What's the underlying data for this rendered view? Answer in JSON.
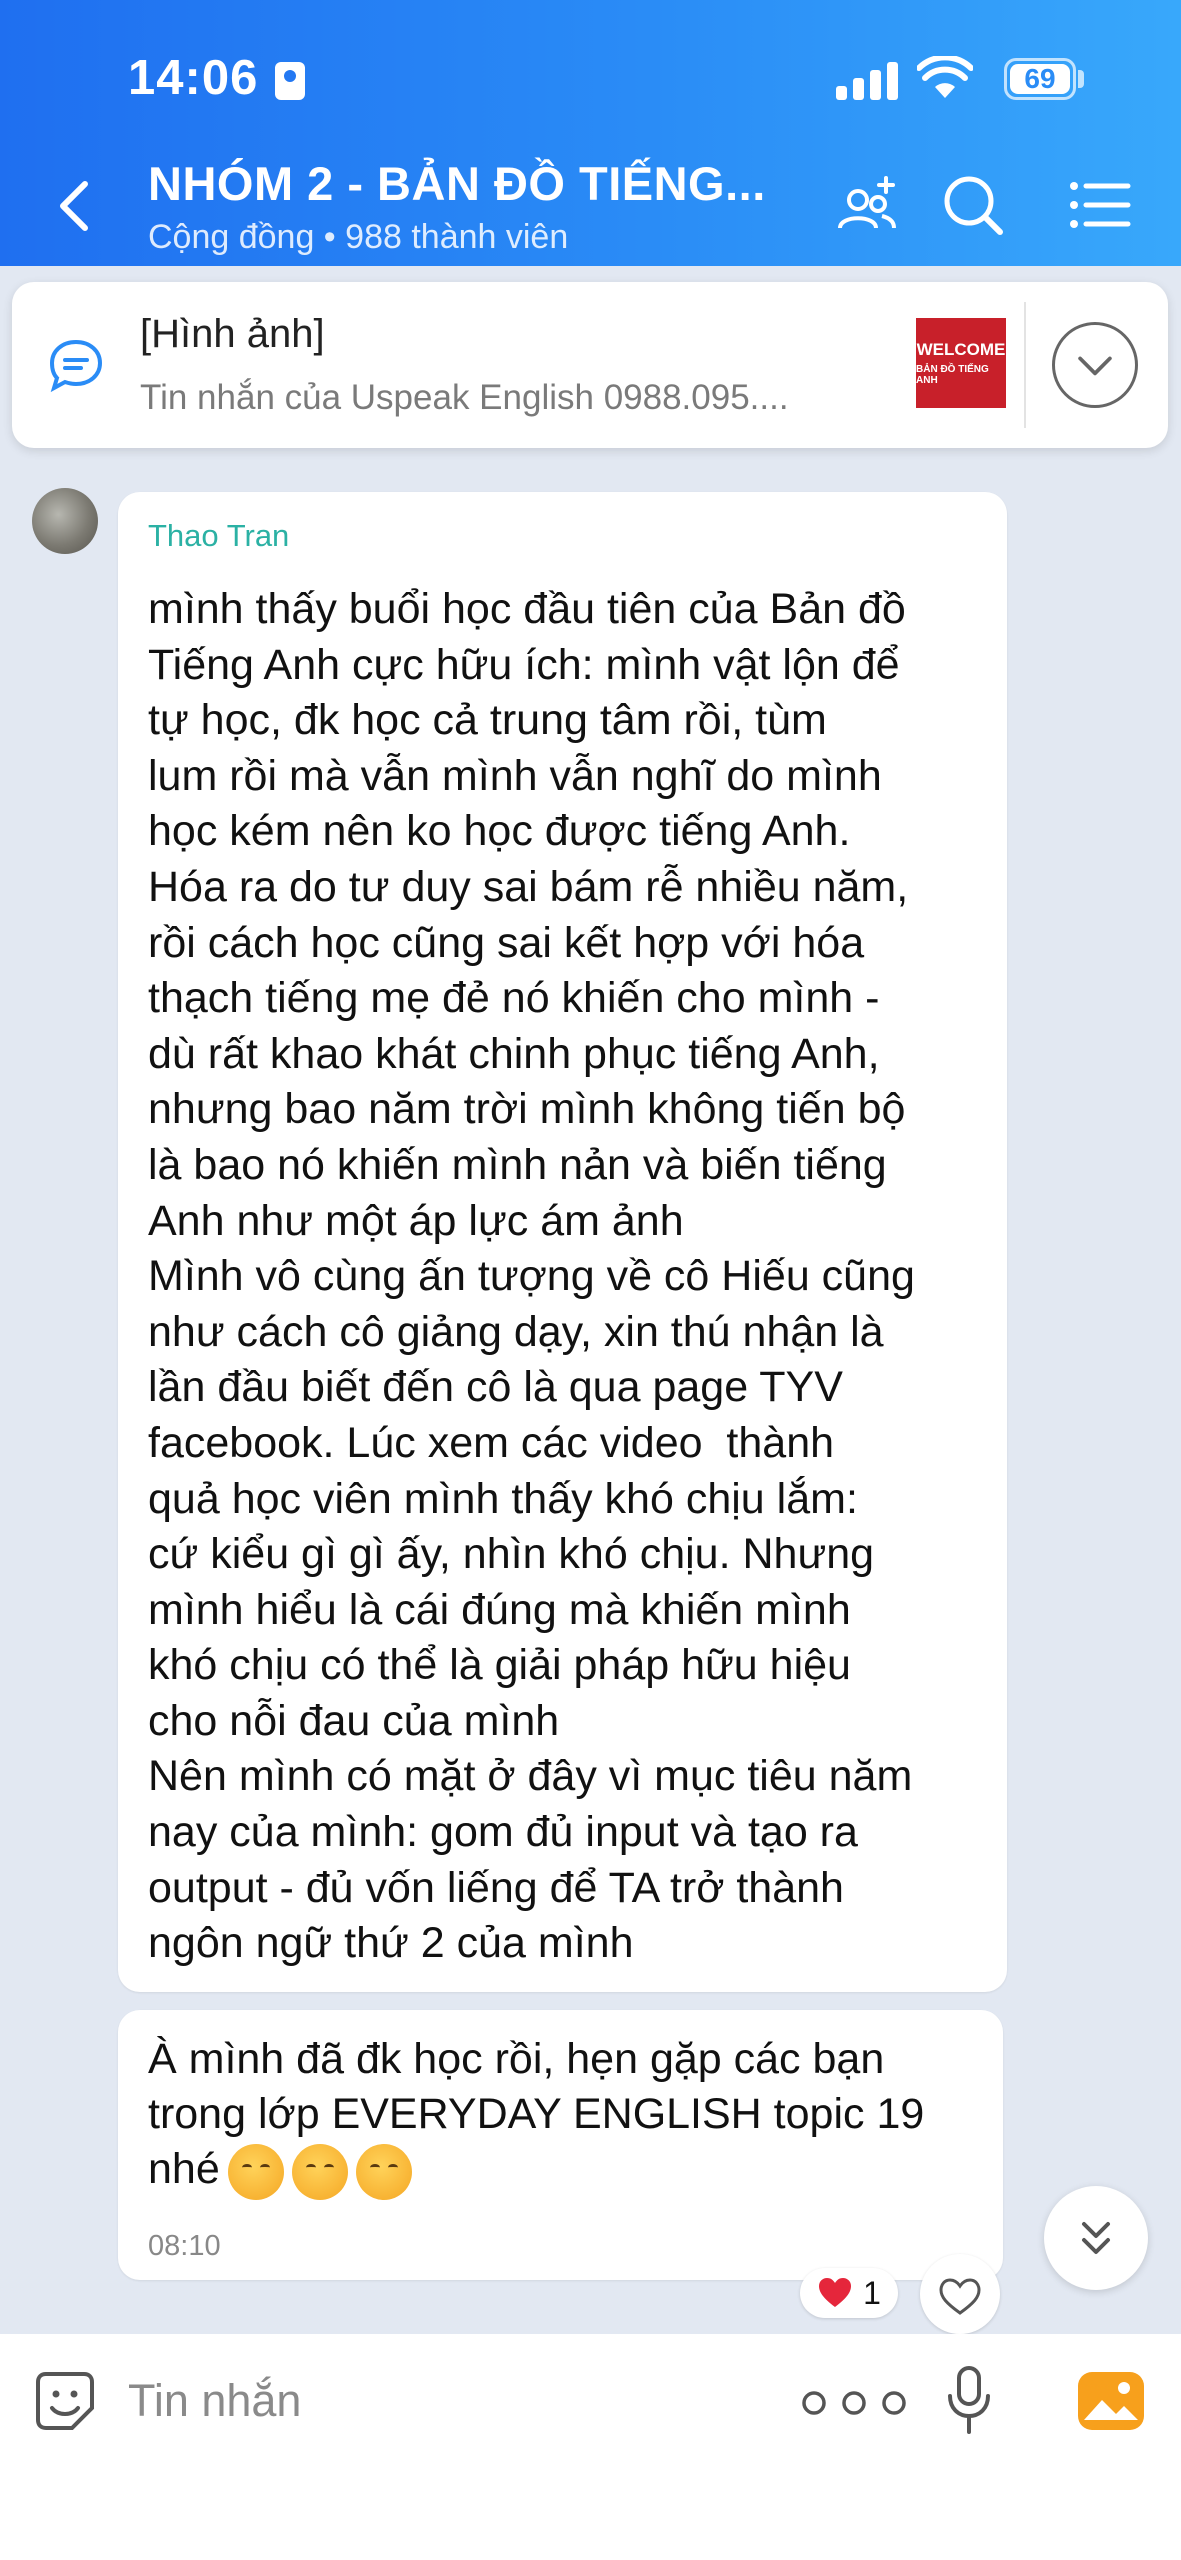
{
  "status_bar": {
    "time": "14:06",
    "battery": "69"
  },
  "header": {
    "title": "NHÓM 2 - BẢN ĐỒ TIẾNG...",
    "subtitle": "Cộng đồng • 988 thành viên"
  },
  "pinned": {
    "title": "[Hình ảnh]",
    "subtitle": "Tin nhắn của Uspeak English 0988.095....",
    "thumb_line1": "WELCOME",
    "thumb_line2": "BẢN ĐỒ TIẾNG ANH"
  },
  "messages": [
    {
      "sender": "Thao Tran",
      "text": "mình thấy buổi học đầu tiên của Bản đồ\nTiếng Anh cực hữu ích: mình vật lộn để\ntự học, đk học cả trung tâm rồi, tùm\nlum rồi mà vẫn mình vẫn nghĩ do mình\nhọc kém nên ko học được tiếng Anh.\nHóa ra do tư duy sai bám rễ nhiều năm,\nrồi cách học cũng sai kết hợp với hóa\nthạch tiếng mẹ đẻ nó khiến cho mình -\ndù rất khao khát chinh phục tiếng Anh,\nnhưng bao năm trời mình không tiến bộ\nlà bao nó khiến mình nản và biến tiếng\nAnh như một áp lực ám ảnh\nMình vô cùng ấn tượng về cô Hiếu cũng\nnhư cách cô giảng dạy, xin thú nhận là\nlần đầu biết đến cô là qua page TYV\nfacebook. Lúc xem các video  thành\nquả học viên mình thấy khó chịu lắm:\ncứ kiểu gì gì ấy, nhìn khó chịu. Nhưng\nmình hiểu là cái đúng mà khiến mình\nkhó chịu có thể là giải pháp hữu hiệu\ncho nỗi đau của mình\nNên mình có mặt ở đây vì mục tiêu năm\nnay của mình: gom đủ input và tạo ra\noutput - đủ vốn liếng để TA trở thành\nngôn ngữ thứ 2 của mình"
    },
    {
      "text": "À mình đã đk học rồi, hẹn gặp các bạn\ntrong lớp EVERYDAY ENGLISH topic 19\nnhé",
      "time": "08:10",
      "reaction_count": "1"
    }
  ],
  "input": {
    "placeholder": "Tin nhắn"
  },
  "icons": {
    "back": "chevron-left-icon",
    "members": "add-members-icon",
    "search": "search-icon",
    "menu": "list-menu-icon",
    "pinned": "chat-bubble-icon",
    "expand": "chevron-down-icon",
    "scroll": "double-chevron-down-icon",
    "sticker": "sticker-smile-icon",
    "more": "more-dots-icon",
    "mic": "mic-icon",
    "image": "image-icon"
  },
  "colors": {
    "header": "#2a8cf6",
    "sender": "#2bb1a4",
    "heart": "#e5263b",
    "image_icon": "#f7a01c"
  }
}
